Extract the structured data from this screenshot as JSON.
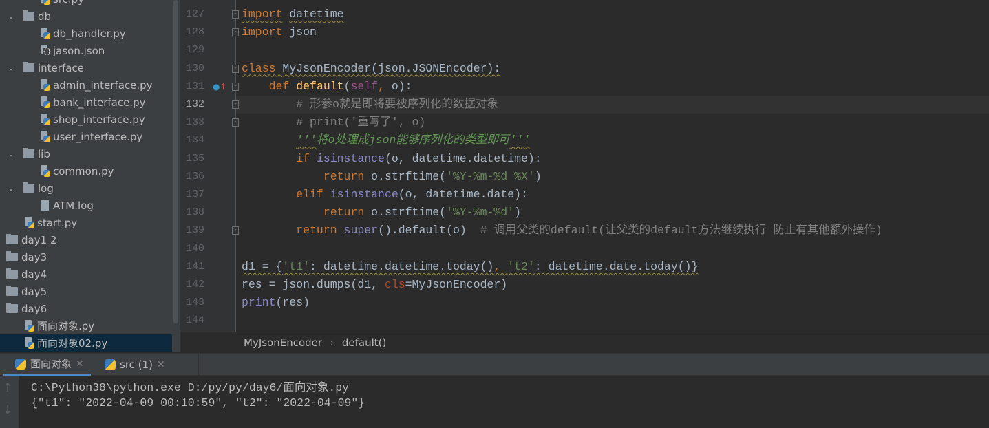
{
  "tree": [
    {
      "label": "src.py",
      "type": "py",
      "depth": 1
    },
    {
      "label": "db",
      "type": "folder",
      "depth": 0,
      "open": true
    },
    {
      "label": "db_handler.py",
      "type": "py",
      "depth": 1
    },
    {
      "label": "jason.json",
      "type": "json",
      "depth": 1
    },
    {
      "label": "interface",
      "type": "folder",
      "depth": 0,
      "open": true
    },
    {
      "label": "admin_interface.py",
      "type": "py",
      "depth": 1
    },
    {
      "label": "bank_interface.py",
      "type": "py",
      "depth": 1
    },
    {
      "label": "shop_interface.py",
      "type": "py",
      "depth": 1
    },
    {
      "label": "user_interface.py",
      "type": "py",
      "depth": 1
    },
    {
      "label": "lib",
      "type": "folder",
      "depth": 0,
      "open": true
    },
    {
      "label": "common.py",
      "type": "py",
      "depth": 1
    },
    {
      "label": "log",
      "type": "folder",
      "depth": 0,
      "open": true
    },
    {
      "label": "ATM.log",
      "type": "log",
      "depth": 1
    },
    {
      "label": "start.py",
      "type": "py",
      "depth": 0
    },
    {
      "label": "day1 2",
      "type": "folder",
      "depth": -1
    },
    {
      "label": "day3",
      "type": "folder",
      "depth": -1
    },
    {
      "label": "day4",
      "type": "folder",
      "depth": -1
    },
    {
      "label": "day5",
      "type": "folder",
      "depth": -1
    },
    {
      "label": "day6",
      "type": "folder",
      "depth": -1
    },
    {
      "label": "面向对象.py",
      "type": "py",
      "depth": 0
    },
    {
      "label": "面向对象02.py",
      "type": "py",
      "depth": 0,
      "selected": true
    }
  ],
  "editor": {
    "current_line": "132",
    "lines": [
      {
        "n": "127",
        "t": [
          [
            "import",
            "kw wavy"
          ],
          [
            " ",
            ""
          ],
          [
            "datetime",
            "wavy"
          ]
        ]
      },
      {
        "n": "128",
        "t": [
          [
            "import",
            "kw"
          ],
          [
            " json",
            ""
          ]
        ]
      },
      {
        "n": "129",
        "t": []
      },
      {
        "n": "130",
        "t": [
          [
            "class",
            "kw wavy"
          ],
          [
            " ",
            "wavy"
          ],
          [
            "MyJsonEncoder(json.JSONEncoder):",
            "wavy"
          ]
        ]
      },
      {
        "n": "131",
        "t": [
          [
            "    ",
            ""
          ],
          [
            "def",
            "kw"
          ],
          [
            " ",
            ""
          ],
          [
            "default",
            "fn"
          ],
          [
            "(",
            ""
          ],
          [
            "self",
            "self"
          ],
          [
            ", ",
            "kw"
          ],
          [
            "o):",
            ""
          ]
        ]
      },
      {
        "n": "132",
        "t": [
          [
            "        # 形参o就是即将要被序列化的数据对象",
            "cm"
          ]
        ]
      },
      {
        "n": "133",
        "t": [
          [
            "        # print('重写了', o)",
            "cm"
          ]
        ]
      },
      {
        "n": "134",
        "t": [
          [
            "        ",
            ""
          ],
          [
            "'''",
            "doc wavy"
          ],
          [
            "将o处理成json能够序列化的类型即可",
            "doc"
          ],
          [
            "'''",
            "doc wavy"
          ]
        ]
      },
      {
        "n": "135",
        "t": [
          [
            "        ",
            ""
          ],
          [
            "if",
            "kw"
          ],
          [
            " ",
            ""
          ],
          [
            "isinstance",
            "bi"
          ],
          [
            "(o, datetime.datetime):",
            ""
          ]
        ]
      },
      {
        "n": "136",
        "t": [
          [
            "            ",
            ""
          ],
          [
            "return",
            "kw"
          ],
          [
            " o.strftime(",
            ""
          ],
          [
            "'%Y-%m-%d %X'",
            "str"
          ],
          [
            ")",
            ""
          ]
        ]
      },
      {
        "n": "137",
        "t": [
          [
            "        ",
            ""
          ],
          [
            "elif",
            "kw"
          ],
          [
            " ",
            ""
          ],
          [
            "isinstance",
            "bi"
          ],
          [
            "(o, datetime.date):",
            ""
          ]
        ]
      },
      {
        "n": "138",
        "t": [
          [
            "            ",
            ""
          ],
          [
            "return",
            "kw"
          ],
          [
            " o.strftime(",
            ""
          ],
          [
            "'%Y-%m-%d'",
            "str"
          ],
          [
            ")",
            ""
          ]
        ]
      },
      {
        "n": "139",
        "t": [
          [
            "        ",
            ""
          ],
          [
            "return",
            "kw"
          ],
          [
            " ",
            ""
          ],
          [
            "super",
            "bi"
          ],
          [
            "().default(o)  ",
            ""
          ],
          [
            "# 调用父类的default(让父类的default方法继续执行 防止有其他额外操作)",
            "cm"
          ]
        ]
      },
      {
        "n": "140",
        "t": []
      },
      {
        "n": "141",
        "t": [
          [
            "d1 = {",
            "wavy"
          ],
          [
            "'t1'",
            "str wavy"
          ],
          [
            ": datetime.datetime.today()",
            "wavy"
          ],
          [
            ", ",
            "kw wavy"
          ],
          [
            "'t2'",
            "str wavy"
          ],
          [
            ": datetime.date.today()}",
            "wavy"
          ]
        ]
      },
      {
        "n": "142",
        "t": [
          [
            "res = json.dumps(d1, ",
            ""
          ],
          [
            "cls",
            "param"
          ],
          [
            "=MyJsonEncoder)",
            ""
          ]
        ]
      },
      {
        "n": "143",
        "t": [
          [
            "print",
            "bi"
          ],
          [
            "(res)",
            ""
          ]
        ]
      },
      {
        "n": "144",
        "t": []
      }
    ]
  },
  "breadcrumb": {
    "class": "MyJsonEncoder",
    "method": "default()"
  },
  "run_tabs": [
    {
      "label": "面向对象",
      "active": true
    },
    {
      "label": "src (1)",
      "active": false
    }
  ],
  "console": {
    "cmd": "C:\\Python38\\python.exe D:/py/py/day6/面向对象.py",
    "output": "{\"t1\": \"2022-04-09 00:10:59\", \"t2\": \"2022-04-09\"}"
  }
}
